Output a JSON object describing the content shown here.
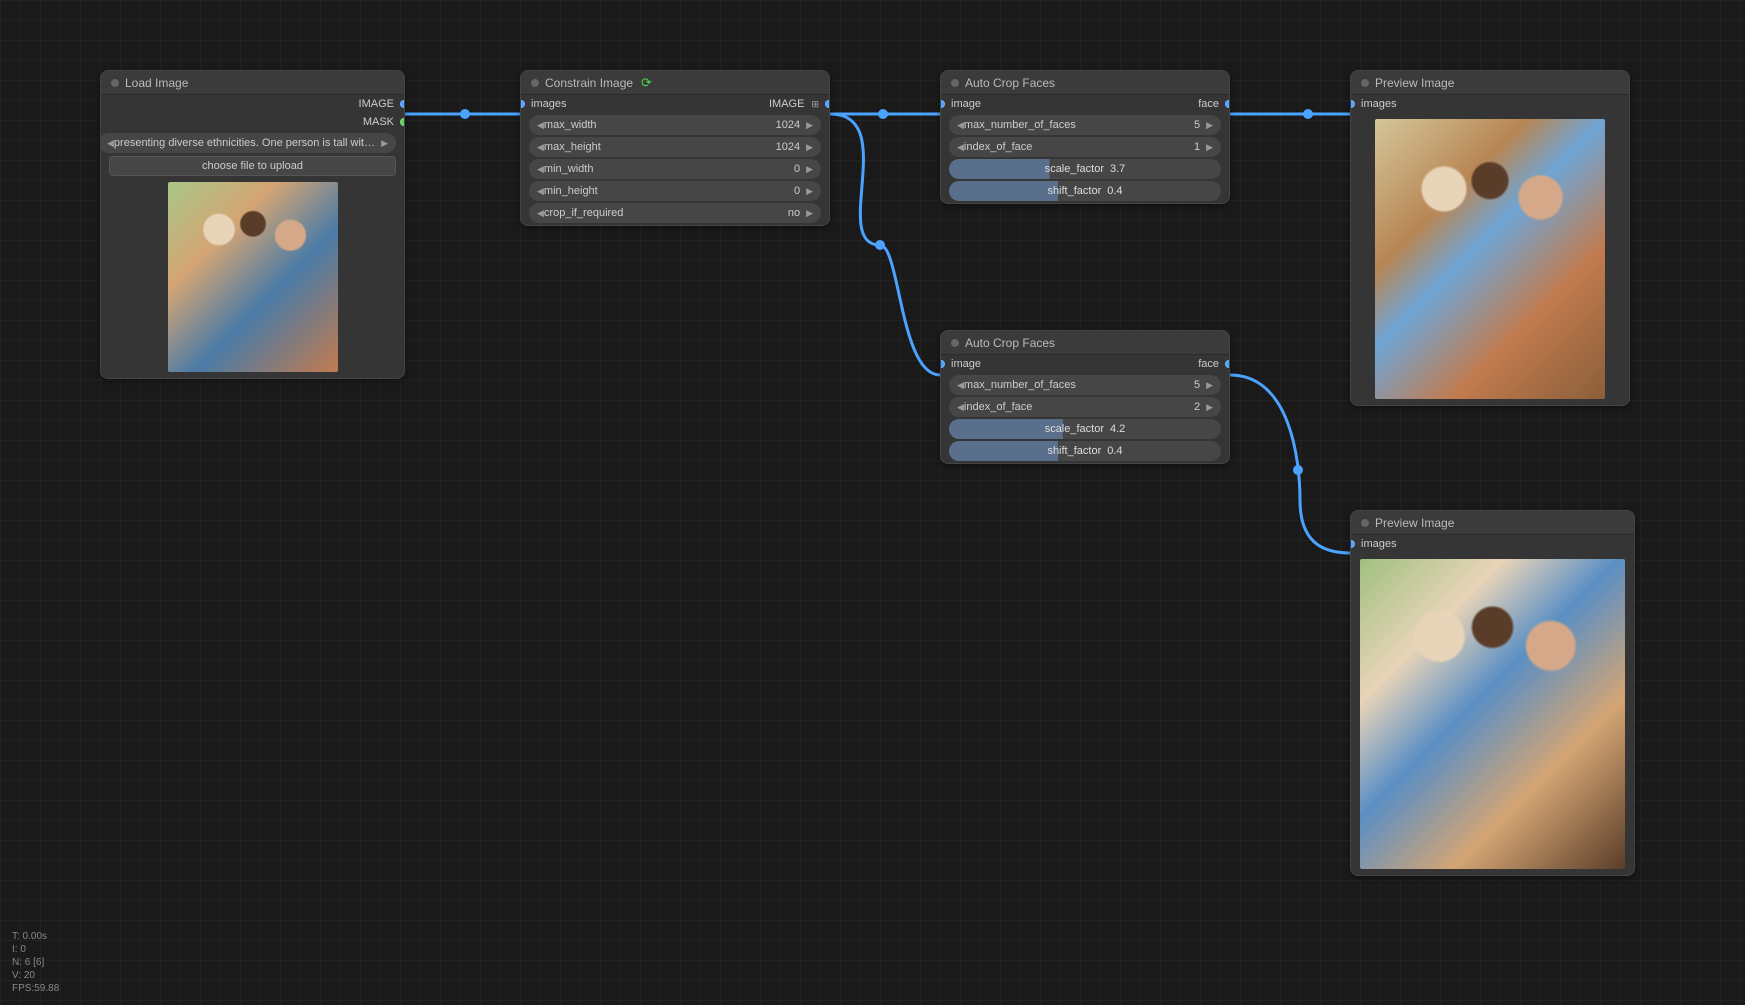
{
  "nodes": {
    "load_image": {
      "title": "Load Image",
      "outputs": {
        "image": "IMAGE",
        "mask": "MASK"
      },
      "filename": "presenting diverse ethnicities. One person is tall with long brow.webp",
      "upload_button": "choose file to upload"
    },
    "constrain": {
      "title": "Constrain Image",
      "inputs": {
        "images": "images"
      },
      "outputs": {
        "image": "IMAGE"
      },
      "max_width": {
        "label": "max_width",
        "value": "1024"
      },
      "max_height": {
        "label": "max_height",
        "value": "1024"
      },
      "min_width": {
        "label": "min_width",
        "value": "0"
      },
      "min_height": {
        "label": "min_height",
        "value": "0"
      },
      "crop_if_required": {
        "label": "crop_if_required",
        "value": "no"
      }
    },
    "autocrop1": {
      "title": "Auto Crop Faces",
      "inputs": {
        "image": "image"
      },
      "outputs": {
        "face": "face"
      },
      "max_faces": {
        "label": "max_number_of_faces",
        "value": "5"
      },
      "index": {
        "label": "index_of_face",
        "value": "1"
      },
      "scale": {
        "label": "scale_factor",
        "value": "3.7"
      },
      "shift": {
        "label": "shift_factor",
        "value": "0.4"
      }
    },
    "autocrop2": {
      "title": "Auto Crop Faces",
      "inputs": {
        "image": "image"
      },
      "outputs": {
        "face": "face"
      },
      "max_faces": {
        "label": "max_number_of_faces",
        "value": "5"
      },
      "index": {
        "label": "index_of_face",
        "value": "2"
      },
      "scale": {
        "label": "scale_factor",
        "value": "4.2"
      },
      "shift": {
        "label": "shift_factor",
        "value": "0.4"
      }
    },
    "preview1": {
      "title": "Preview Image",
      "inputs": {
        "images": "images"
      }
    },
    "preview2": {
      "title": "Preview Image",
      "inputs": {
        "images": "images"
      }
    }
  },
  "stats": {
    "l1": "T: 0.00s",
    "l2": "I: 0",
    "l3": "N: 6 [6]",
    "l4": "V: 20",
    "l5": "FPS:59.88"
  }
}
